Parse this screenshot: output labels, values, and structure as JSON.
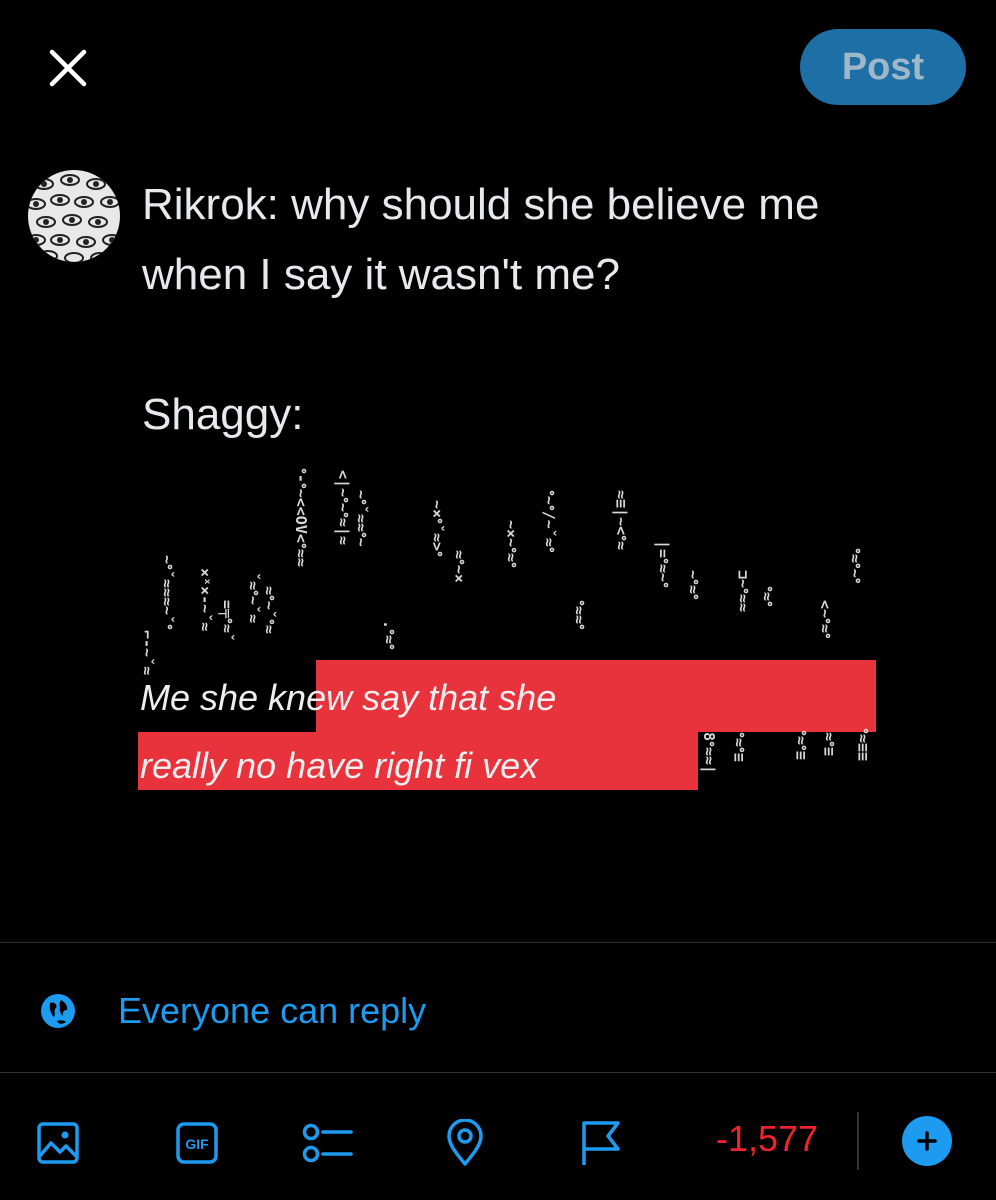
{
  "header": {
    "close_icon": "close-icon",
    "post_label": "Post"
  },
  "compose": {
    "avatar_icon": "avatar-pattern",
    "lines": [
      "Rikrok: why should she believe me",
      "when I say it wasn't me?",
      "",
      "Shaggy:"
    ],
    "glitch_text_line1": "Me she knew say that she",
    "glitch_text_line2": "really no have right fi vex"
  },
  "reply": {
    "icon": "globe-icon",
    "label": "Everyone can reply"
  },
  "toolbar": {
    "icons": [
      "image-icon",
      "gif-icon",
      "poll-icon",
      "location-icon",
      "flag-icon"
    ],
    "gif_label": "GIF",
    "char_counter": "-1,577",
    "add_icon": "plus-icon"
  },
  "colors": {
    "accent": "#1d9bf0",
    "post_button_bg": "#1d6fa5",
    "counter_red": "#f4212e",
    "glitch_red": "#e8323c",
    "background": "#000000"
  }
}
